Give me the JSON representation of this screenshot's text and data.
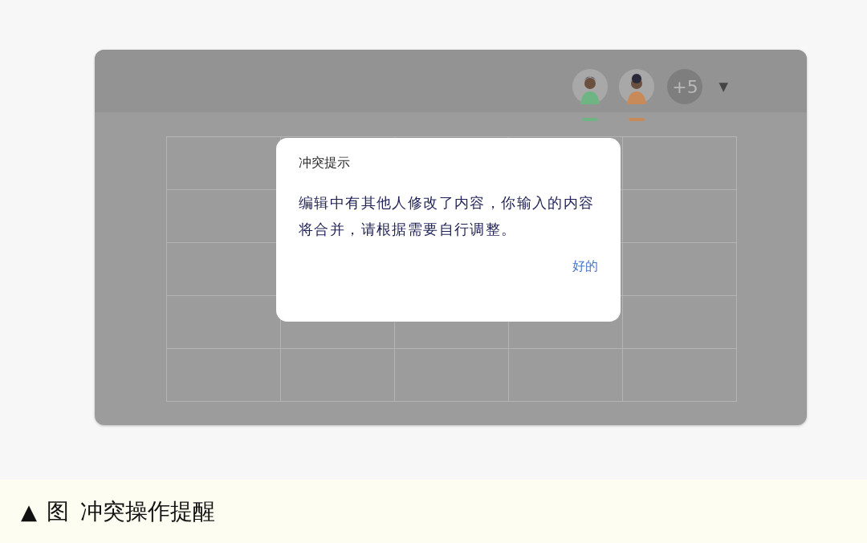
{
  "window": {
    "collaborators": [
      {
        "color": "#6fb584"
      },
      {
        "color": "#c98a5a"
      }
    ],
    "more_count": "+5",
    "menu_caret": "▼"
  },
  "dialog": {
    "title": "冲突提示",
    "message": "编辑中有其他人修改了内容，你输入的内容将合并，请根据需要自行调整。",
    "button": "好的"
  },
  "caption": {
    "marker": "▲",
    "label": "图",
    "text": "冲突操作提醒"
  }
}
